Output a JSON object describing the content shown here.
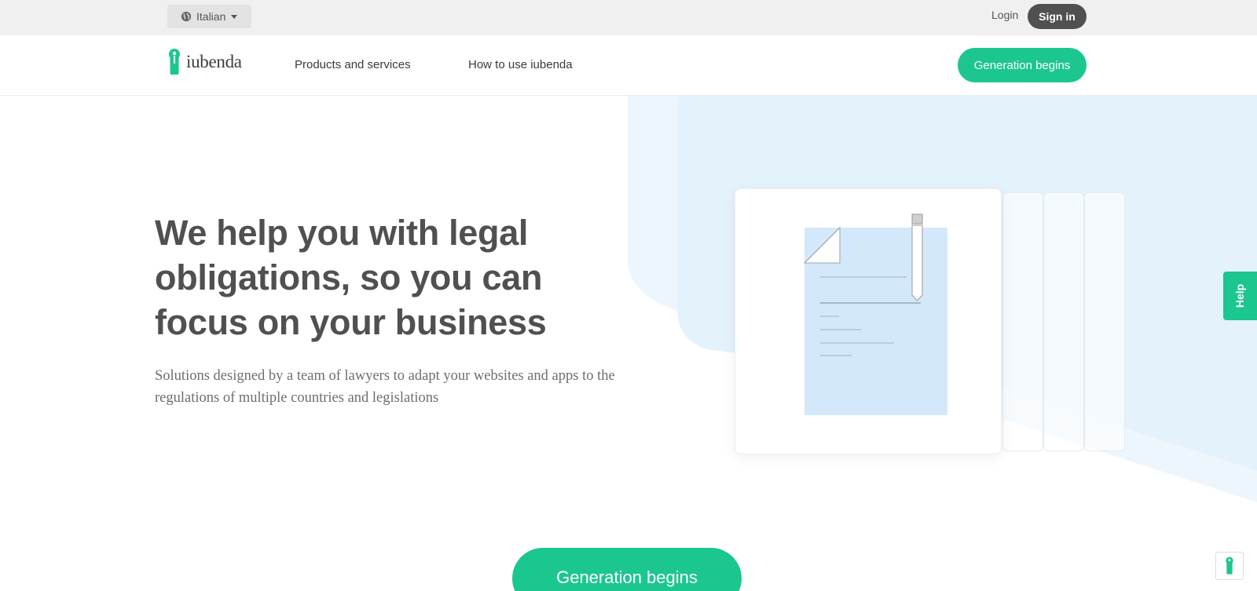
{
  "topbar": {
    "language": "Italian",
    "login": "Login",
    "signin": "Sign in"
  },
  "nav": {
    "logo_text": "iubenda",
    "links": [
      "Products and services",
      "How to use iubenda"
    ],
    "cta": "Generation begins"
  },
  "hero": {
    "title": "We help you with legal obligations, so you can focus on your business",
    "subtitle": "Solutions designed by a team of lawyers to adapt your websites and apps to the regulations of multiple countries and legislations",
    "cta": "Generation begins"
  },
  "help": {
    "label": "Help"
  },
  "colors": {
    "brand_green": "#1cc691",
    "dark_button": "#505050",
    "hero_blue": "#e6f3fc",
    "doc_blue": "#d3e9fb"
  },
  "icons": [
    "globe-icon",
    "caret-down-icon",
    "iubenda-logo-icon",
    "document-icon",
    "pencil-icon",
    "iubenda-badge-icon"
  ]
}
